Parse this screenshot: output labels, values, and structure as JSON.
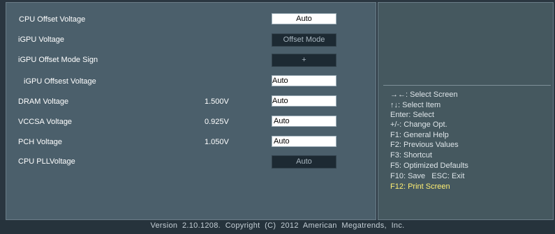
{
  "settings": [
    {
      "label": "CPU Offset Voltage",
      "value": "",
      "control": "Auto"
    },
    {
      "label": "iGPU Voltage",
      "value": "",
      "control": "Offset Mode"
    },
    {
      "label": "iGPU Offset Mode Sign",
      "value": "",
      "control": "+"
    },
    {
      "label": "iGPU Offsest Voltage",
      "value": "",
      "control": "Auto"
    },
    {
      "label": "DRAM Voltage",
      "value": "1.500V",
      "control": "Auto"
    },
    {
      "label": "VCCSA Voltage",
      "value": "0.925V",
      "control": "Auto"
    },
    {
      "label": "PCH Voltage",
      "value": "1.050V",
      "control": "Auto"
    },
    {
      "label": "CPU PLLVoltage",
      "value": "",
      "control": "Auto"
    }
  ],
  "help": [
    "→←: Select Screen",
    "↑↓: Select Item",
    "Enter: Select",
    "+/-: Change Opt.",
    "F1: General Help",
    "F2: Previous Values",
    "F3: Shortcut",
    "F5: Optimized Defaults",
    "F10: Save   ESC: Exit",
    "F12: Print Screen"
  ],
  "footer": "Version  2.10.1208.  Copyright  (C)  2012  American  Megatrends,  Inc.",
  "colors": {
    "highlight": "#ffef73",
    "panel": "#4b5f6b",
    "dark_field": "#1d2a33"
  }
}
